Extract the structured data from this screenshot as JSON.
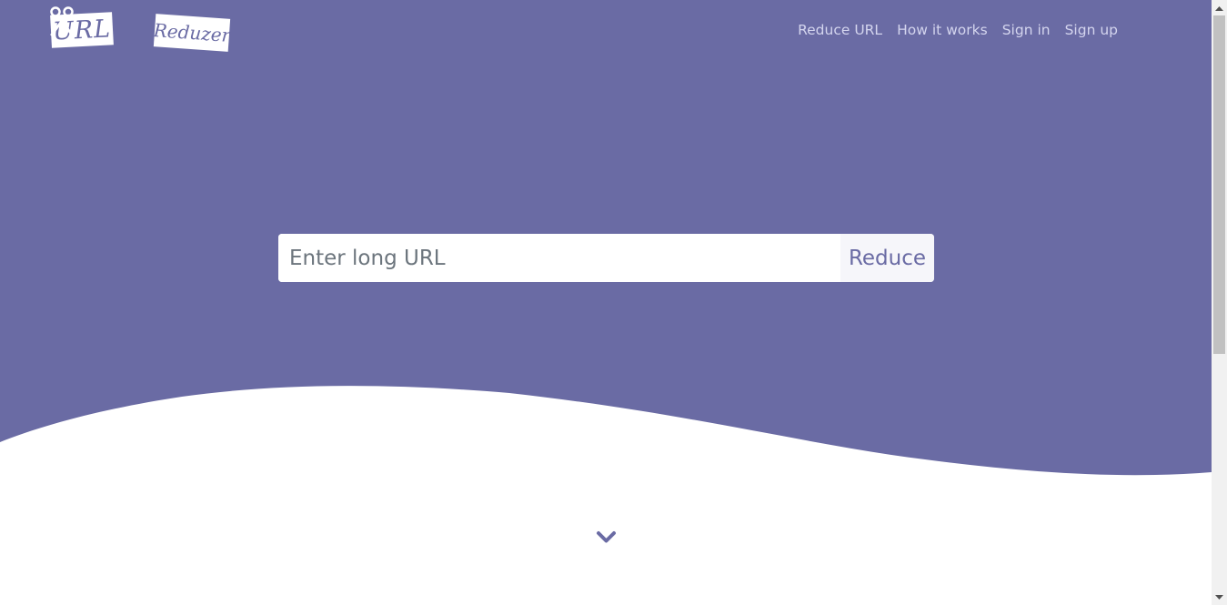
{
  "logo": {
    "part1": "URL",
    "part2": "Reduzer",
    "icon": "scissors-icon"
  },
  "nav": {
    "items": [
      {
        "label": "Reduce URL"
      },
      {
        "label": "How it works"
      },
      {
        "label": "Sign in"
      },
      {
        "label": "Sign up"
      }
    ]
  },
  "search": {
    "placeholder": "Enter long URL",
    "value": "",
    "button_label": "Reduce"
  },
  "scroll_hint": {
    "icon": "chevron-down-icon"
  },
  "colors": {
    "hero_background": "#6a6ba4",
    "nav_text": "#d4d5ee",
    "button_text": "#6a6ba4",
    "page_background": "#ffffff"
  }
}
